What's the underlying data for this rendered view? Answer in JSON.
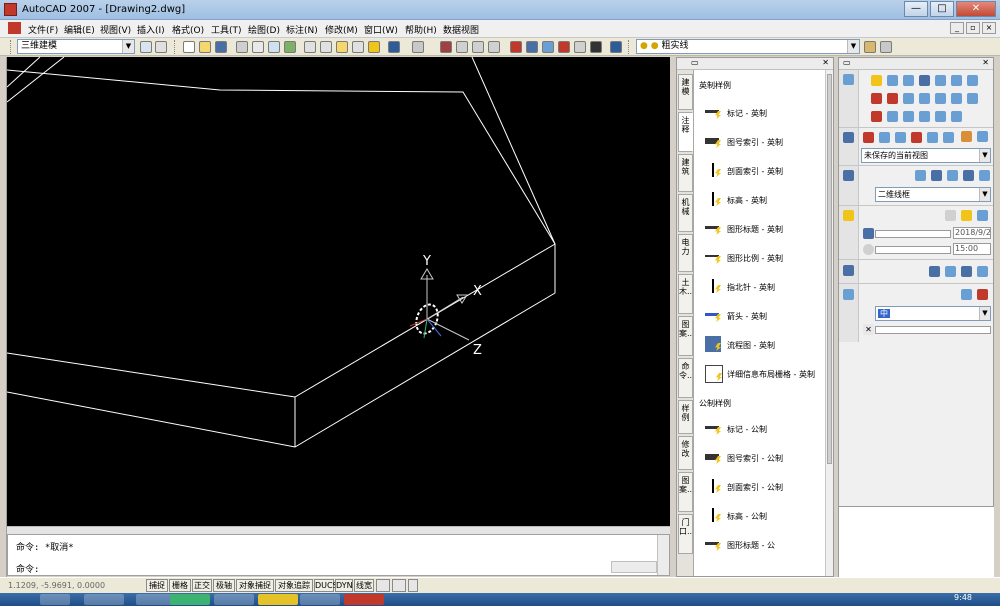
{
  "window": {
    "title": "AutoCAD 2007 - [Drawing2.dwg]",
    "buttons": [
      "—",
      "□",
      "✕"
    ]
  },
  "menu": {
    "items": [
      "文件(F)",
      "编辑(E)",
      "视图(V)",
      "插入(I)",
      "格式(O)",
      "工具(T)",
      "绘图(D)",
      "标注(N)",
      "修改(M)",
      "窗口(W)",
      "帮助(H)",
      "数据视图"
    ],
    "mdi_buttons": [
      "_",
      "▫",
      "×"
    ]
  },
  "toolbar": {
    "workspace": "三维建模",
    "layer": "粗实线"
  },
  "canvas": {
    "background": "#000000",
    "ucs_labels": [
      "Y",
      "X",
      "Z"
    ]
  },
  "command": {
    "line1": "命令: *取消*",
    "line2": "命令:"
  },
  "status": {
    "coords": "1.1209, -5.9691, 0.0000",
    "buttons": [
      "捕捉",
      "栅格",
      "正交",
      "极轴",
      "对象捕捉",
      "对象追踪",
      "DUCS",
      "DYN",
      "线宽"
    ]
  },
  "tool_palette": {
    "tabs": [
      "建模",
      "注释",
      "建筑",
      "机械",
      "电力",
      "土木...",
      "图案...",
      "命令...",
      "样例",
      "修改",
      "图案...",
      "门口..."
    ],
    "active_tab": 1,
    "section1": "英制样例",
    "tools_imperial": [
      "标记 - 英制",
      "图号索引 - 英制",
      "剖面索引 - 英制",
      "标高 - 英制",
      "图形标题 - 英制",
      "图形比例 - 英制",
      "指北针 - 英制",
      "箭头 - 英制",
      "流程图 - 英制",
      "详细信息布局栅格 - 英制"
    ],
    "section2": "公制样例",
    "tools_metric": [
      "标记 - 公制",
      "图号索引 - 公制",
      "剖面索引 - 公制",
      "标高 - 公制",
      "图形标题 - 公"
    ]
  },
  "dashboard": {
    "view_combo": "未保存的当前视图",
    "visual_style": "二维线框",
    "date_value": "2018/9/2",
    "time_value": "15:00",
    "material_value": "中"
  },
  "taskbar": {
    "clock": "9:48"
  }
}
